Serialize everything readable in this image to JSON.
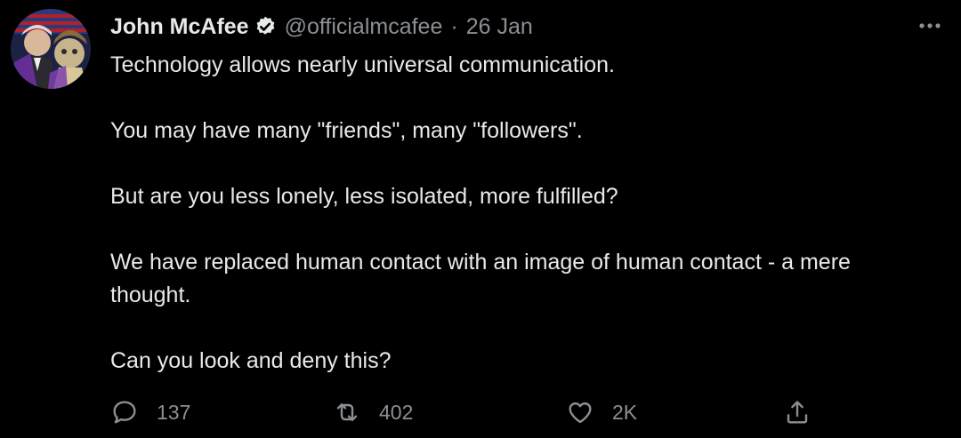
{
  "tweet": {
    "author": {
      "display_name": "John McAfee",
      "verified": true,
      "handle": "@officialmcafee",
      "separator": "·",
      "timestamp": "26 Jan"
    },
    "paragraphs": [
      "Technology allows nearly universal communication.",
      "You may have many \"friends\", many \"followers\".",
      "But are you less lonely, less isolated, more fulfilled?",
      "We have replaced human contact with an image of human contact - a mere thought.",
      "Can you look and deny this?"
    ],
    "actions": {
      "reply_count": "137",
      "retweet_count": "402",
      "like_count": "2K"
    }
  },
  "icons": {
    "more": "more-horizontal-icon",
    "verified": "verified-badge-icon",
    "reply": "reply-icon",
    "retweet": "retweet-icon",
    "like": "heart-icon",
    "share": "share-icon"
  },
  "colors": {
    "background": "#000000",
    "text_primary": "#e7e9ea",
    "text_secondary": "#8b8f94"
  }
}
